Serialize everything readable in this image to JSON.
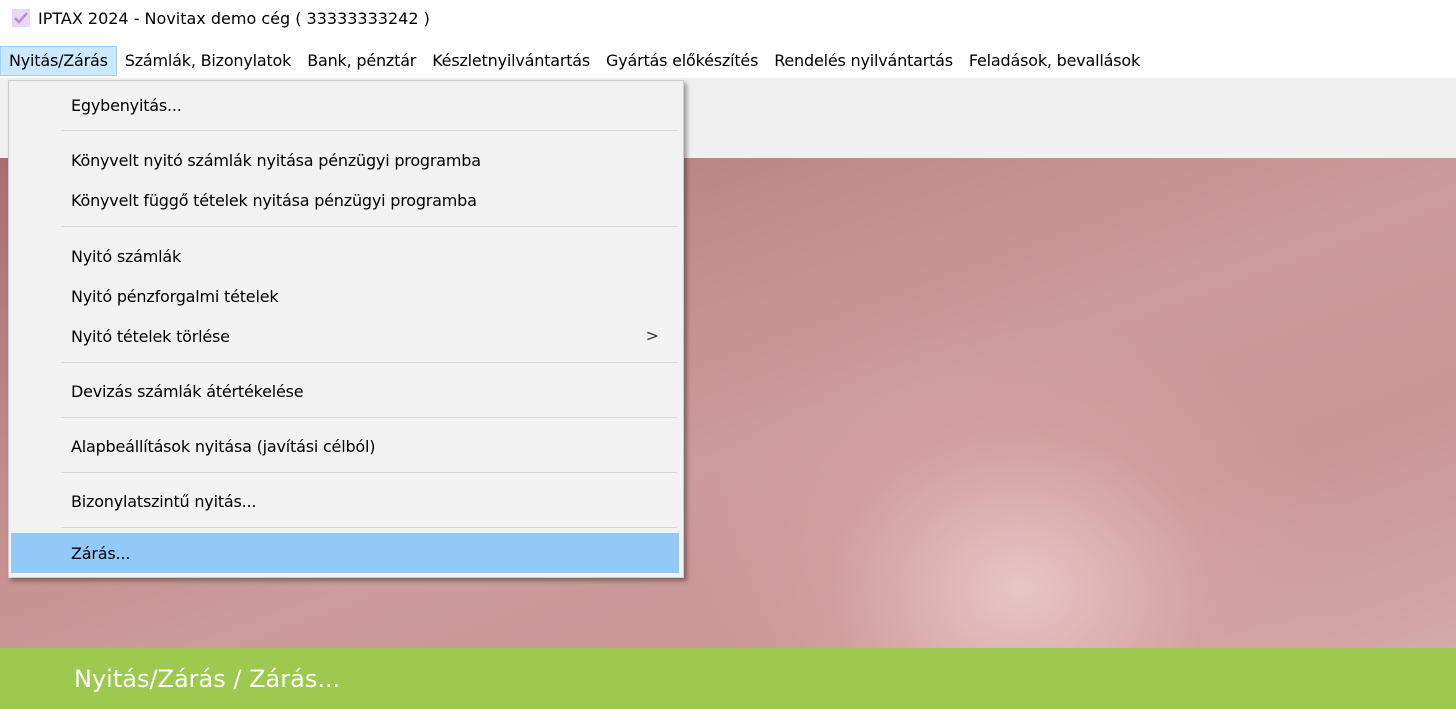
{
  "window": {
    "title": "IPTAX 2024 - Novitax demo cég ( 33333333242 )",
    "icon": "checkmark-icon",
    "accent_color": "#b98bd1"
  },
  "menubar": {
    "items": [
      {
        "label": "Nyitás/Zárás",
        "active": true
      },
      {
        "label": "Számlák, Bizonylatok"
      },
      {
        "label": "Bank, pénztár"
      },
      {
        "label": "Készletnyilvántartás"
      },
      {
        "label": "Gyártás előkészítés"
      },
      {
        "label": "Rendelés nyilvántartás"
      },
      {
        "label": "Feladások, bevallások"
      }
    ]
  },
  "dropdown": {
    "items": [
      {
        "label": "Egybenyitás..."
      },
      {
        "label": "Könyvelt nyitó számlák nyitása pénzügyi programba"
      },
      {
        "label": "Könyvelt függő tételek nyitása pénzügyi programba"
      },
      {
        "label": "Nyitó számlák"
      },
      {
        "label": "Nyitó pénzforgalmi tételek"
      },
      {
        "label": "Nyitó tételek törlése",
        "submenu_arrow": ">"
      },
      {
        "label": "Devizás számlák átértékelése"
      },
      {
        "label": "Alapbeállítások nyitása (javítási célból)"
      },
      {
        "label": "Bizonylatszintű nyitás..."
      },
      {
        "label": "Zárás...",
        "highlighted": true
      }
    ]
  },
  "statusbar": {
    "text": "Nyitás/Zárás / Zárás...",
    "color": "#9dc94e"
  }
}
